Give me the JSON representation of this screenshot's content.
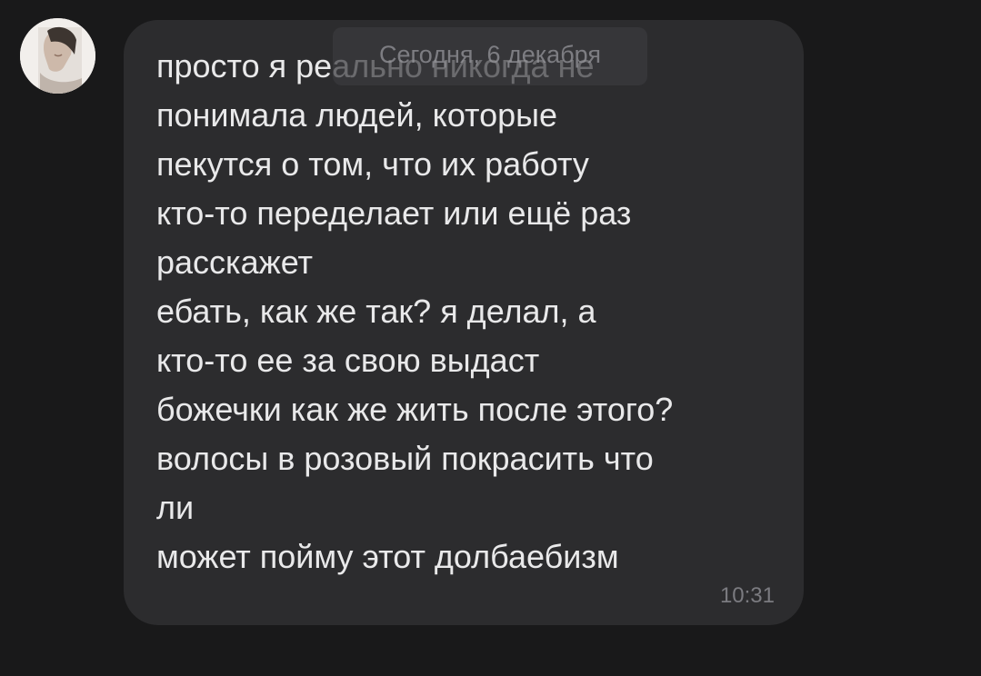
{
  "sender": {
    "avatar_icon": "profile-photo"
  },
  "date_separator": "Сегодня, 6 декабря",
  "message": {
    "lines": [
      "просто я реально никогда не",
      "понимала людей, которые",
      "пекутся о том, что их работу",
      "кто-то переделает или ещё раз",
      "расскажет",
      "ебать, как же так? я делал, а",
      "кто-то ее за свою выдаст",
      "божечки как же жить после этого?",
      "волосы в розовый покрасить что",
      "ли",
      "может пойму этот долбаебизм"
    ],
    "time": "10:31"
  },
  "colors": {
    "background": "#19191a",
    "bubble": "#2c2c2e",
    "text": "#e9e9ea",
    "time": "#7b7b80"
  }
}
